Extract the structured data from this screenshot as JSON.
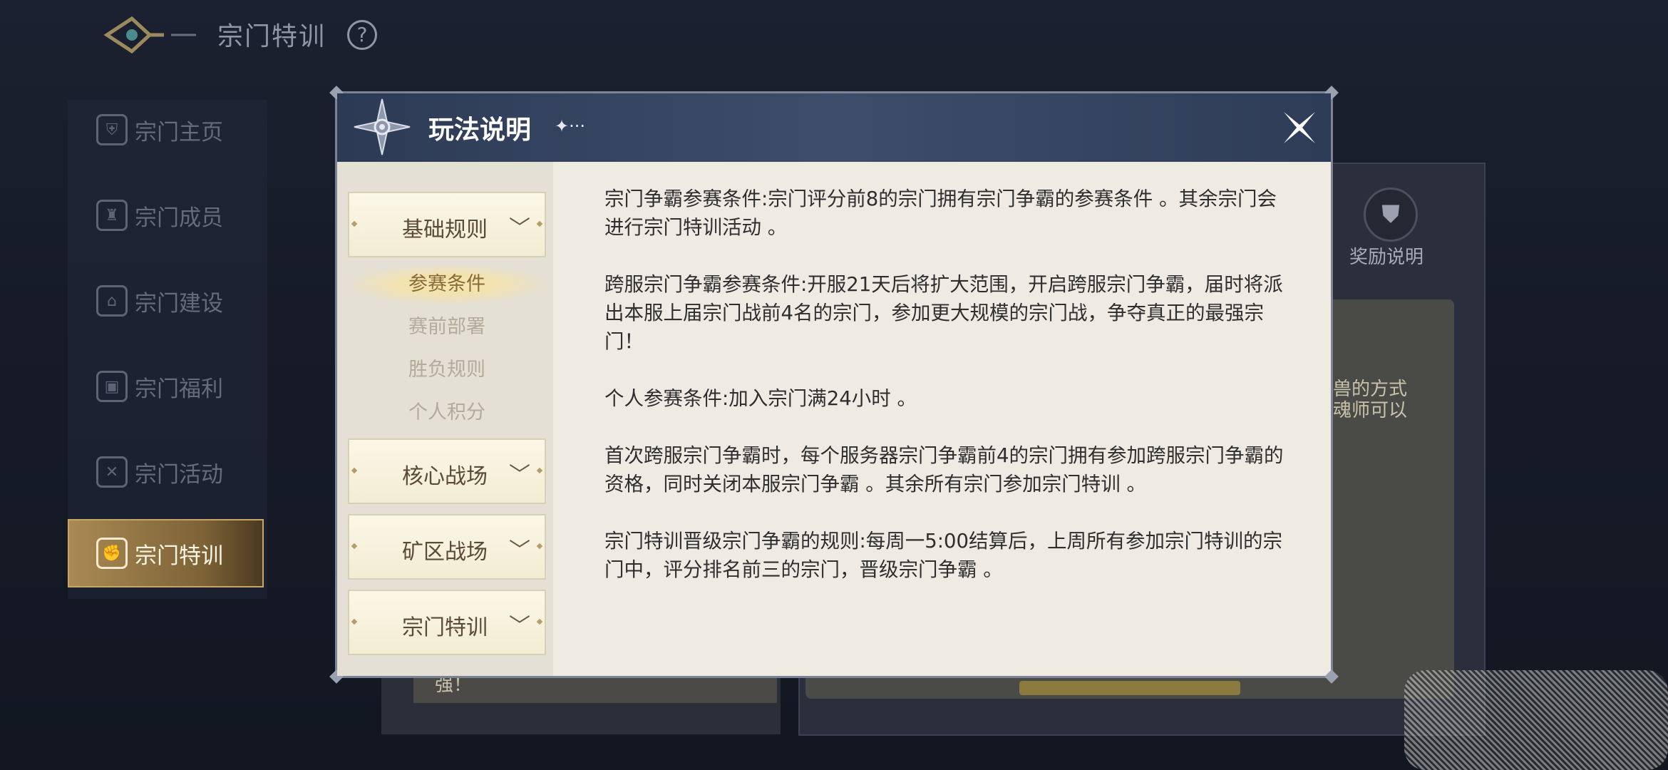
{
  "header": {
    "title": "宗门特训",
    "help": "?"
  },
  "sidebar": {
    "items": [
      {
        "label": "宗门主页",
        "icon": "shield-icon"
      },
      {
        "label": "宗门成员",
        "icon": "helmet-icon"
      },
      {
        "label": "宗门建设",
        "icon": "building-icon"
      },
      {
        "label": "宗门福利",
        "icon": "gift-icon"
      },
      {
        "label": "宗门活动",
        "icon": "swords-icon"
      },
      {
        "label": "宗门特训",
        "icon": "fist-icon",
        "active": true
      }
    ]
  },
  "background": {
    "reward_label": "奖励说明",
    "fragment_right_1": "兽的方式",
    "fragment_right_2": "魂师可以",
    "fragment_left": "强！"
  },
  "modal": {
    "title": "玩法说明",
    "title_deco": "✦···",
    "categories": [
      {
        "label": "基础规则",
        "expanded": true,
        "subitems": [
          "参赛条件",
          "赛前部署",
          "胜负规则",
          "个人积分"
        ],
        "active_subitem": "参赛条件"
      },
      {
        "label": "核心战场",
        "expanded": false
      },
      {
        "label": "矿区战场",
        "expanded": false
      },
      {
        "label": "宗门特训",
        "expanded": false
      }
    ],
    "paragraphs": [
      "宗门争霸参赛条件:宗门评分前8的宗门拥有宗门争霸的参赛条件 。其余宗门会进行宗门特训活动 。",
      "跨服宗门争霸参赛条件:开服21天后将扩大范围，开启跨服宗门争霸，届时将派出本服上届宗门战前4名的宗门，参加更大规模的宗门战，争夺真正的最强宗门！",
      "个人参赛条件:加入宗门满24小时 。",
      "首次跨服宗门争霸时，每个服务器宗门争霸前4的宗门拥有参加跨服宗门争霸的资格，同时关闭本服宗门争霸 。其余所有宗门参加宗门特训 。",
      "宗门特训晋级宗门争霸的规则:每周一5:00结算后，上周所有参加宗门特训的宗门中，评分排名前三的宗门，晋级宗门争霸 。"
    ]
  },
  "colors": {
    "modal_header": "#34445f",
    "active_sidebar": "#a98a53",
    "panel_bg": "#efebe3"
  }
}
